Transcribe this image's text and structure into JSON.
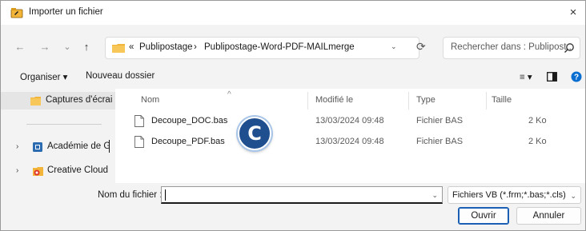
{
  "window": {
    "title": "Importer un fichier",
    "close_glyph": "×"
  },
  "nav": {
    "back_glyph": "←",
    "forward_glyph": "→",
    "recent_glyph": "⌄",
    "up_glyph": "↑",
    "crumb_overflow": "«",
    "breadcrumbs": [
      "Publipostage",
      "Publipostage-Word-PDF-MAILmerge"
    ],
    "crumb_separator": "›",
    "refresh_glyph": "⟳",
    "search_placeholder": "Rechercher dans : Publipost..."
  },
  "toolbar": {
    "organize_label": "Organiser ▾",
    "new_folder_label": "Nouveau dossier",
    "view_glyph": "≡ ▾"
  },
  "sidebar": {
    "items": [
      {
        "label": "Captures d'écrai",
        "selected": true
      },
      {
        "label": "Académie de Gr",
        "chevron": "›"
      },
      {
        "label": "Creative Cloud F",
        "chevron": "›"
      }
    ]
  },
  "files": {
    "columns": [
      "Nom",
      "Modifié le",
      "Type",
      "Taille"
    ],
    "sort_glyph": "^",
    "rows": [
      {
        "name": "Decoupe_DOC.bas",
        "modified": "13/03/2024 09:48",
        "type": "Fichier BAS",
        "size": "2 Ko"
      },
      {
        "name": "Decoupe_PDF.bas",
        "modified": "13/03/2024 09:48",
        "type": "Fichier BAS",
        "size": "2 Ko"
      }
    ]
  },
  "badge": {
    "letter": "C"
  },
  "footer": {
    "filename_label": "Nom du fichier :",
    "filename_value": "",
    "filetype_value": "Fichiers VB (*.frm;*.bas;*.cls)",
    "open_label": "Ouvrir",
    "cancel_label": "Annuler"
  },
  "colors": {
    "accent": "#1a5fb4",
    "folder": "#f2b53a",
    "badge": "#1f4f8f",
    "help": "#0a6ed1"
  },
  "icons": [
    "app-icon",
    "close-icon",
    "back-icon",
    "forward-icon",
    "history-icon",
    "up-icon",
    "folder-icon",
    "refresh-icon",
    "search-icon",
    "view-icon",
    "preview-pane-icon",
    "help-icon",
    "file-icon",
    "badge-c"
  ]
}
